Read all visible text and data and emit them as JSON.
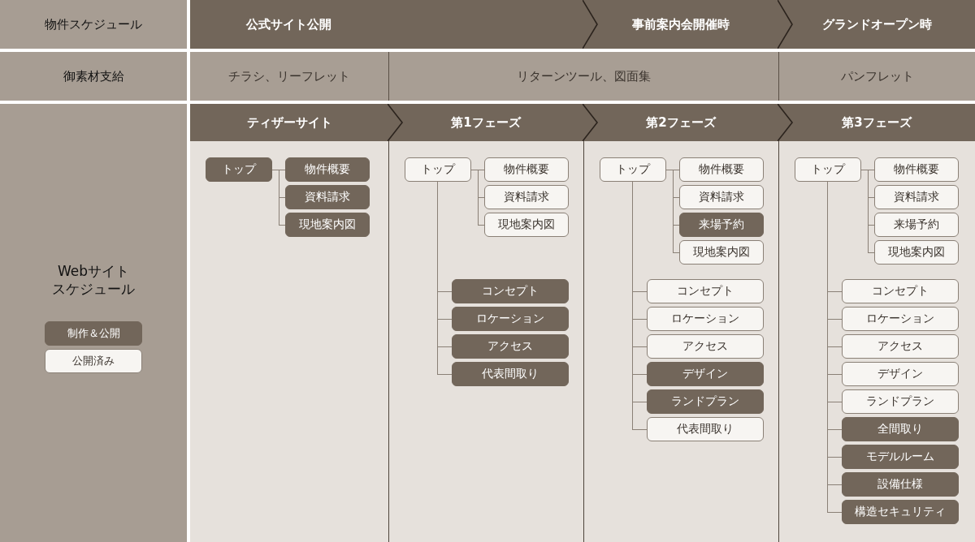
{
  "schedule": {
    "label": "物件スケジュール",
    "items": [
      {
        "label": "公式サイト公開",
        "merged_with_next": true
      },
      {
        "label": "事前案内会開催時",
        "merged_with_next": false
      },
      {
        "label": "グランドオープン時",
        "merged_with_next": false
      }
    ]
  },
  "materials": {
    "label": "御素材支給",
    "items": [
      {
        "label": "チラシ、リーフレット",
        "merged_with_next": false
      },
      {
        "label": "リターンツール、図面集",
        "merged_with_next": true
      },
      {
        "label": "パンフレット",
        "merged_with_next": false
      }
    ]
  },
  "website": {
    "title_lines": [
      "Webサイト",
      "スケジュール"
    ],
    "legend": [
      {
        "label": "制作＆公開",
        "produced": true
      },
      {
        "label": "公開済み",
        "produced": false
      }
    ],
    "phases": [
      {
        "label": "ティザーサイト",
        "top": {
          "label": "トップ",
          "produced": true
        },
        "pages": [
          {
            "label": "物件概要",
            "produced": true
          },
          {
            "label": "資料請求",
            "produced": true
          },
          {
            "label": "現地案内図",
            "produced": true
          }
        ]
      },
      {
        "label": "第1フェーズ",
        "top": {
          "label": "トップ",
          "produced": false
        },
        "pages": [
          {
            "label": "物件概要",
            "produced": false
          },
          {
            "label": "資料請求",
            "produced": false
          },
          {
            "label": "現地案内図",
            "produced": false
          }
        ],
        "sections": [
          {
            "label": "コンセプト",
            "produced": true
          },
          {
            "label": "ロケーション",
            "produced": true
          },
          {
            "label": "アクセス",
            "produced": true
          },
          {
            "label": "代表間取り",
            "produced": true
          }
        ]
      },
      {
        "label": "第2フェーズ",
        "top": {
          "label": "トップ",
          "produced": false
        },
        "pages": [
          {
            "label": "物件概要",
            "produced": false
          },
          {
            "label": "資料請求",
            "produced": false
          },
          {
            "label": "来場予約",
            "produced": true
          },
          {
            "label": "現地案内図",
            "produced": false
          }
        ],
        "sections": [
          {
            "label": "コンセプト",
            "produced": false
          },
          {
            "label": "ロケーション",
            "produced": false
          },
          {
            "label": "アクセス",
            "produced": false
          },
          {
            "label": "デザイン",
            "produced": true
          },
          {
            "label": "ランドプラン",
            "produced": true
          },
          {
            "label": "代表間取り",
            "produced": false
          }
        ]
      },
      {
        "label": "第3フェーズ",
        "top": {
          "label": "トップ",
          "produced": false
        },
        "pages": [
          {
            "label": "物件概要",
            "produced": false
          },
          {
            "label": "資料請求",
            "produced": false
          },
          {
            "label": "来場予約",
            "produced": false
          },
          {
            "label": "現地案内図",
            "produced": false
          }
        ],
        "sections": [
          {
            "label": "コンセプト",
            "produced": false
          },
          {
            "label": "ロケーション",
            "produced": false
          },
          {
            "label": "アクセス",
            "produced": false
          },
          {
            "label": "デザイン",
            "produced": false
          },
          {
            "label": "ランドプラン",
            "produced": false
          },
          {
            "label": "全間取り",
            "produced": true
          },
          {
            "label": "モデルルーム",
            "produced": true
          },
          {
            "label": "設備仕様",
            "produced": true
          },
          {
            "label": "構造セキュリティ",
            "produced": true
          }
        ]
      }
    ]
  }
}
